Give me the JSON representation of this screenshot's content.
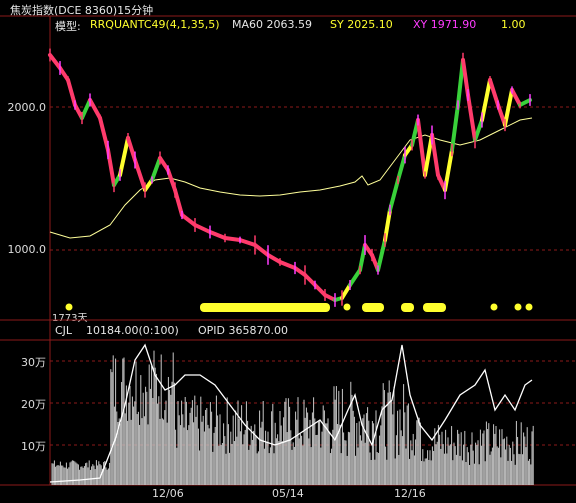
{
  "header": {
    "title": "焦炭指数(DCE 8360)15分钟"
  },
  "indicators": {
    "model_label": "模型:",
    "model_value": "RRQUANTC49(4,1,35,5)",
    "ma60": "MA60 2063.59",
    "sy": "SY 2025.10",
    "xy": "XY 1971.90",
    "last": "1.00"
  },
  "price_axis": {
    "labels": [
      "2000.0",
      "1000.0"
    ]
  },
  "days_label": "1773天",
  "volume_panel": {
    "cjl": "CJL",
    "cjl_value": "10184.00(0:100)",
    "opid": "OPID 365870.00",
    "axis_labels": [
      "30万",
      "20万",
      "10万"
    ]
  },
  "x_axis": {
    "labels": [
      "12/06",
      "05/14",
      "12/16"
    ]
  },
  "colors": {
    "background": "#000000",
    "grid": "#8b1a1a",
    "price_up": "#ff3b6b",
    "price_mid": "#39d13a",
    "price_hi": "#ffff2e",
    "ma_line": "#ffff9a",
    "xy": "#ff3cff",
    "volume": "#c8c8c8",
    "open_interest": "#ffffff"
  }
}
